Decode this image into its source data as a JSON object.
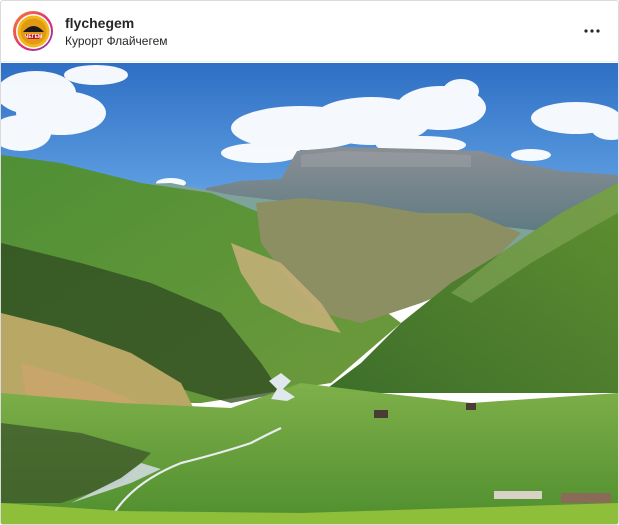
{
  "post": {
    "username": "flychegem",
    "location": "Курорт Флайчегем",
    "avatar_icon": "paraglider-logo-icon",
    "more_icon": "more-options-icon"
  },
  "colors": {
    "sky": "#3f86d4",
    "mountain": "#6f7f8e",
    "grass": "#4c8a2f",
    "logo": "#e8a81d"
  }
}
